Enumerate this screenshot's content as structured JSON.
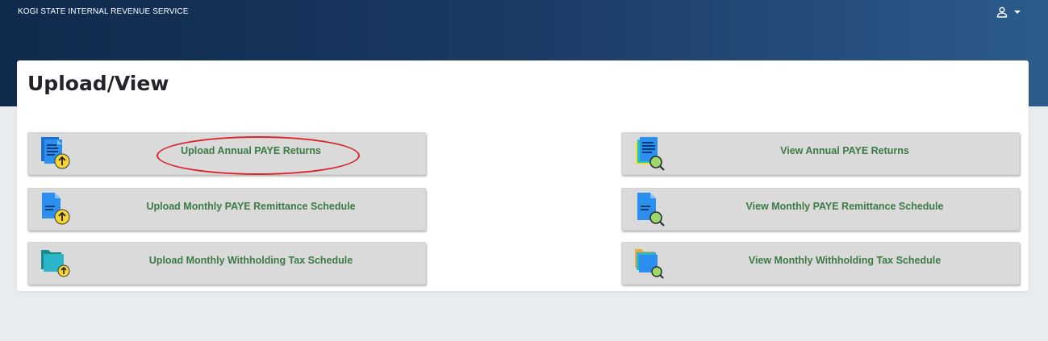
{
  "header": {
    "brand": "KOGI STATE INTERNAL REVENUE SERVICE",
    "user_icon": "user-icon",
    "menu_icon": "caret-down-icon",
    "background_colors": [
      "#0f2a4c",
      "#2c5b8c"
    ]
  },
  "page": {
    "title": "Upload/View"
  },
  "upload_tiles": [
    {
      "label": "Upload Annual PAYE Returns",
      "icon": "document-upload-icon",
      "highlighted": true
    },
    {
      "label": "Upload Monthly PAYE Remittance Schedule",
      "icon": "file-upload-icon",
      "highlighted": false
    },
    {
      "label": "Upload Monthly Withholding Tax Schedule",
      "icon": "folder-upload-icon",
      "highlighted": false
    }
  ],
  "view_tiles": [
    {
      "label": "View Annual PAYE Returns",
      "icon": "document-search-icon"
    },
    {
      "label": "View Monthly PAYE Remittance Schedule",
      "icon": "file-search-icon"
    },
    {
      "label": "View Monthly Withholding Tax Schedule",
      "icon": "folder-search-icon"
    }
  ],
  "colors": {
    "tile_text": "#3c7a45",
    "tile_background": "#dadada",
    "annotation": "#d8232a"
  }
}
